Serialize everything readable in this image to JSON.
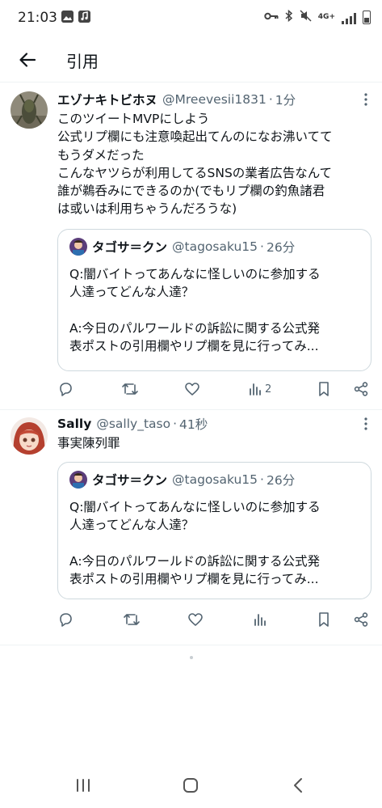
{
  "status_bar": {
    "time": "21:03",
    "network": "4G+"
  },
  "header": {
    "title": "引用"
  },
  "tweets": [
    {
      "display_name": "エゾナキトビホヌ",
      "handle": "@Mreevesii1831",
      "time": "1分",
      "text": "このツイートMVPにしよう\n公式リプ欄にも注意喚起出てんのになお沸いてて\nもうダメだった\nこんなヤツらが利用してるSNSの業者広告なんて\n誰が鵜呑みにできるのか(でもリプ欄の釣魚諸君\nは或いは利用ちゃうんだろうな)",
      "quote": {
        "display_name": "タゴサ＝クン",
        "handle": "@tagosaku15",
        "time": "26分",
        "text": "Q:闇バイトってあんなに怪しいのに参加する\n人達ってどんな人達？\n\nA:今日のパルワールドの訴訟に関する公式発\n表ポストの引用欄やリプ欄を見に行ってみ..."
      },
      "views": "2"
    },
    {
      "display_name": "Sally",
      "handle": "@sally_taso",
      "time": "41秒",
      "text": "事実陳列罪",
      "quote": {
        "display_name": "タゴサ＝クン",
        "handle": "@tagosaku15",
        "time": "26分",
        "text": "Q:闇バイトってあんなに怪しいのに参加する\n人達ってどんな人達？\n\nA:今日のパルワールドの訴訟に関する公式発\n表ポストの引用欄やリプ欄を見に行ってみ..."
      },
      "views": ""
    }
  ],
  "colors": {
    "text_primary": "#0f1419",
    "text_secondary": "#536471",
    "border": "#cfd9de",
    "divider": "#eff3f4"
  },
  "icons": [
    "back-arrow-icon",
    "more-icon",
    "reply-icon",
    "retweet-icon",
    "like-icon",
    "views-icon",
    "bookmark-icon",
    "share-icon",
    "recent-apps-icon",
    "home-icon",
    "back-nav-icon"
  ]
}
